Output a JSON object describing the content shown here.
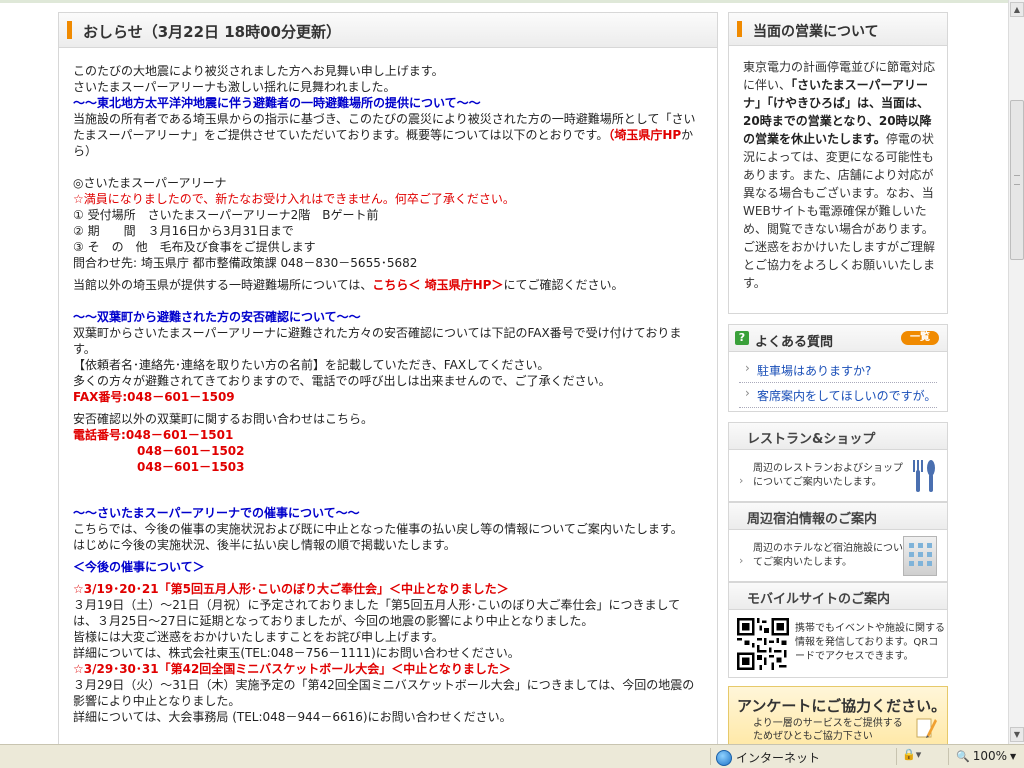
{
  "notice": {
    "title": "おしらせ（3月22日 18時00分更新）",
    "intro": [
      "このたびの大地震により被災されました方へお見舞い申し上げます。",
      "さいたまスーパーアリーナも激しい揺れに見舞われました。"
    ],
    "sec1": {
      "heading": "～～東北地方太平洋沖地震に伴う避難者の一時避難場所の提供について～～",
      "body_a": "当施設の所有者である埼玉県からの指示に基づき、このたびの震災により被災された方の一時避難場所として「さいたまスーパーアリーナ」をご提供させていただいております。概要等については以下のとおりです。",
      "link": "（埼玉県庁HP",
      "body_b": "から）",
      "facility": "◎さいたまスーパーアリーナ",
      "full": "☆満員になりましたので、新たなお受け入れはできません。何卒ご了承ください。",
      "items": [
        "① 受付場所　さいたまスーパーアリーナ2階　Bゲート前",
        "② 期　　間　３月16日から3月31日まで",
        "③ そ　の　他　毛布及び食事をご提供します",
        "問合わせ先: 埼玉県庁 都市整備政策課 048－830－5655･5682"
      ],
      "other_a": "当館以外の埼玉県が提供する一時避難場所については、",
      "other_link": "こちら＜ 埼玉県庁HP＞",
      "other_b": "にてご確認ください。"
    },
    "sec2": {
      "heading": "～～双葉町から避難された方の安否確認について～～",
      "body1": "双葉町からさいたまスーパーアリーナに避難された方々の安否確認については下記のFAX番号で受け付けております。",
      "body2": "【依頼者名･連絡先･連絡を取りたい方の名前】を記載していただき、FAXしてください。",
      "body3": "多くの方々が避難されてきておりますので、電話での呼び出しは出来ませんので、ご了承ください。",
      "fax": "FAX番号:048－601－1509",
      "other": "安否確認以外の双葉町に関するお問い合わせはこちら。",
      "tel_label": "電話番号:",
      "tel": [
        "048－601－1501",
        "048－601－1502",
        "048－601－1503"
      ]
    },
    "sec3": {
      "heading": "～～さいたまスーパーアリーナでの催事について～～",
      "body1": "こちらでは、今後の催事の実施状況および既に中止となった催事の払い戻し等の情報についてご案内いたします。",
      "body2": "はじめに今後の実施状況、後半に払い戻し情報の順で掲載いたします。",
      "sub": "＜今後の催事について＞",
      "e1_title": "☆3/19･20･21「第5回五月人形･こいのぼり大ご奉仕会」＜中止となりました＞",
      "e1_body1": "３月19日（土）～21日（月祝）に予定されておりました「第5回五月人形･こいのぼり大ご奉仕会」につきましては、３月25日～27日に延期となっておりましたが、今回の地震の影響により中止となりました。",
      "e1_body2": "皆様には大変ご迷惑をおかけいたしますことをお詫び申し上げます。",
      "e1_body3": "詳細については、株式会社東玉(TEL:048－756－1111)にお問い合わせください。",
      "e2_title": "☆3/29･30･31「第42回全国ミニバスケットボール大会」＜中止となりました＞",
      "e2_body1": "３月29日（火）～31日（木）実施予定の「第42回全国ミニバスケットボール大会」につきましては、今回の地震の影響により中止となりました。",
      "e2_body2": "詳細については、大会事務局 (TEL:048－944－6616)にお問い合わせください。"
    }
  },
  "side": {
    "business": {
      "title": "当面の営業について",
      "t1": "東京電力の計画停電並びに節電対応に伴い、",
      "t2": "「さいたまスーパーアリーナ」「けやきひろば」は、当面は、20時までの営業となり、20時以降の営業を休止いたします。",
      "t3": "停電の状況によっては、変更になる可能性もあります。また、店舗により対応が異なる場合もございます。なお、当WEBサイトも電源確保が難しいため、閲覧できない場合があります。 ご迷惑をおかけいたしますがご理解とご協力をよろしくお願いいたします。"
    },
    "faq": {
      "icon": "?",
      "title": "よくある質問",
      "more": "一覧",
      "items": [
        "駐車場はありますか?",
        "客席案内をしてほしいのですが。"
      ]
    },
    "restaurant": {
      "title": "レストラン&ショップ",
      "text": "周辺のレストランおよびショップについてご案内いたします。"
    },
    "hotel": {
      "title": "周辺宿泊情報のご案内",
      "text": "周辺のホテルなど宿泊施設についてご案内いたします。"
    },
    "mobile": {
      "title": "モバイルサイトのご案内",
      "text": "携帯でもイベントや施設に関する情報を発信しております。QRコードでアクセスできます。"
    },
    "survey": {
      "title": "アンケートにご協力ください。",
      "t1": "より一層のサービスをご提供する",
      "t2": "ためぜひともご協力下さい"
    }
  },
  "statusbar": {
    "zone": "インターネット",
    "zoom": "100%"
  }
}
